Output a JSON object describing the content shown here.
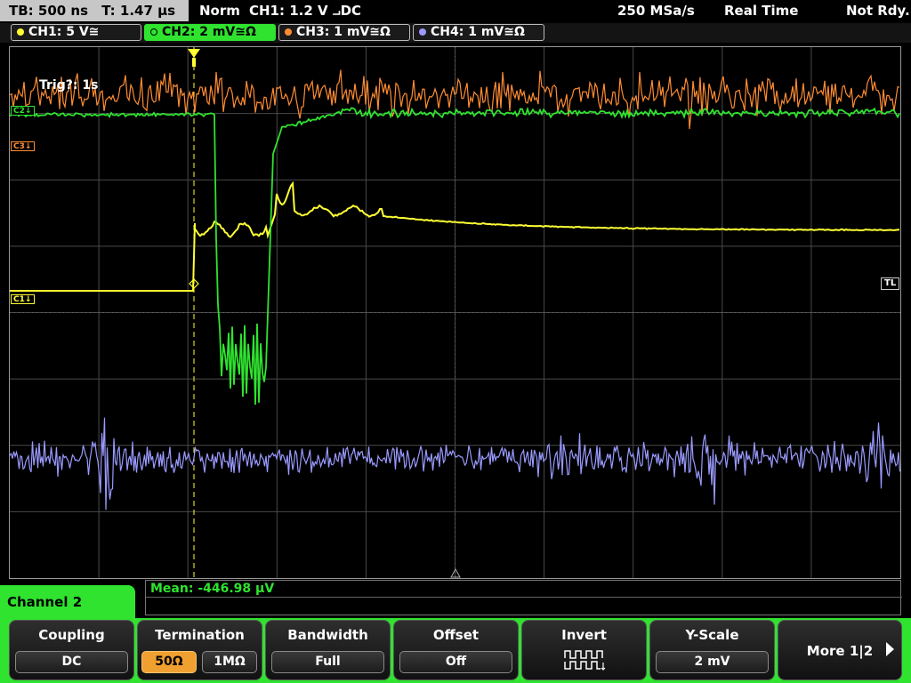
{
  "topbar": {
    "timebase": "TB: 500 ns",
    "trigger_time": "T: 1.47 µs",
    "mode": "Norm",
    "trigger_source": "CH1: 1.2 V ⨼DC",
    "sample_rate": "250 MSa/s",
    "acq_mode": "Real Time",
    "status": "Not Rdy."
  },
  "channels": [
    {
      "label": "CH1: 5 V≅",
      "color": "#ffff33"
    },
    {
      "label": "CH2: 2 mV≅Ω",
      "color": "#2fe32f"
    },
    {
      "label": "CH3: 1 mV≅Ω",
      "color": "#ff8c32"
    },
    {
      "label": "CH4: 1 mV≅Ω",
      "color": "#9a9aff"
    }
  ],
  "scope": {
    "trigger_text": "Trig?: 1s",
    "markers": {
      "c2": "C2",
      "c3": "C3",
      "c1": "C1",
      "tl": "TL"
    }
  },
  "measurement": {
    "mean": "Mean: -446.98 µV"
  },
  "menu": {
    "title": "Channel 2",
    "softkeys": {
      "coupling": {
        "title": "Coupling",
        "value": "DC"
      },
      "termination": {
        "title": "Termination",
        "option_a": "50Ω",
        "option_b": "1MΩ"
      },
      "bandwidth": {
        "title": "Bandwidth",
        "value": "Full"
      },
      "offset": {
        "title": "Offset",
        "value": "Off"
      },
      "invert": {
        "title": "Invert"
      },
      "yscale": {
        "title": "Y-Scale",
        "value": "2 mV"
      },
      "more": {
        "label": "More 1|2"
      }
    }
  }
}
